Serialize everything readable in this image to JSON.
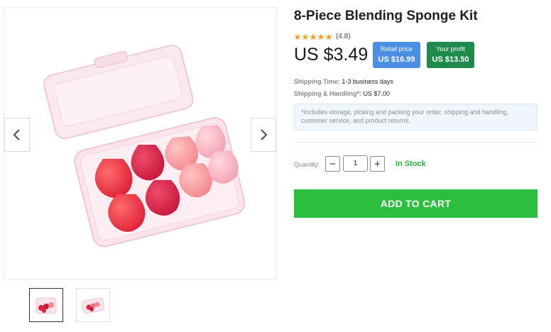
{
  "product": {
    "title": "8-Piece Blending Sponge Kit",
    "rating_value": "(4.8)",
    "rating_stars": 5,
    "price": "US $3.49"
  },
  "badges": {
    "retail_label": "Retail price",
    "retail_value": "US $16.99",
    "profit_label": "Your profit",
    "profit_value": "US $13.50"
  },
  "shipping": {
    "time_label": "Shipping Time:",
    "time_value": "1-3 business days",
    "handling_label": "Shipping & Handling",
    "handling_asterisk": "*",
    "handling_colon": ":",
    "handling_value": "US $7.00",
    "note": "*Includes storage, picking and packing your order, shipping and handling, customer service, and product returns."
  },
  "quantity": {
    "label": "Quantity:",
    "minus": "−",
    "plus": "+",
    "value": "1",
    "stock": "In Stock"
  },
  "cart": {
    "add_label": "ADD TO CART"
  },
  "gallery": {
    "prev_icon": "chevron-left-icon",
    "next_icon": "chevron-right-icon",
    "thumbnail_count": 2,
    "active_thumbnail": 1
  },
  "colors": {
    "retail_badge": "#4a8fe4",
    "profit_badge": "#1e8a4c",
    "in_stock": "#2fae3f",
    "add_to_cart": "#2cbf3e",
    "star": "#f5a623"
  }
}
